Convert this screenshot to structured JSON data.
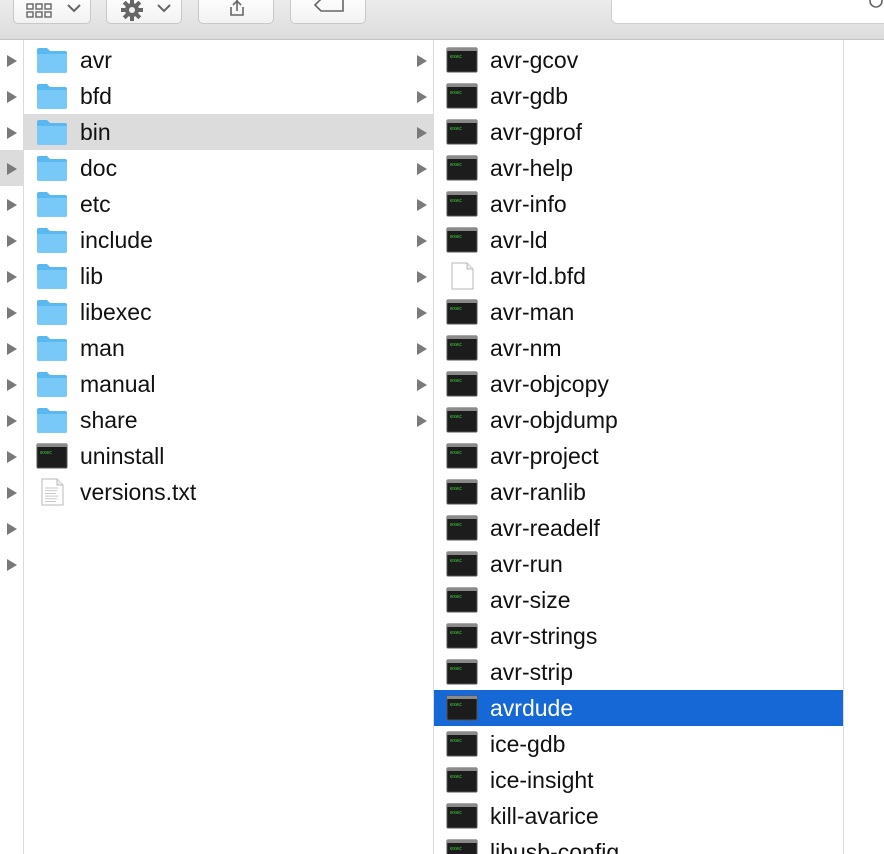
{
  "column_left": {
    "items": [
      {
        "label": "avr",
        "type": "folder",
        "has_children": true
      },
      {
        "label": "bfd",
        "type": "folder",
        "has_children": true
      },
      {
        "label": "bin",
        "type": "folder",
        "has_children": true,
        "selected": true
      },
      {
        "label": "doc",
        "type": "folder",
        "has_children": true
      },
      {
        "label": "etc",
        "type": "folder",
        "has_children": true
      },
      {
        "label": "include",
        "type": "folder",
        "has_children": true
      },
      {
        "label": "lib",
        "type": "folder",
        "has_children": true
      },
      {
        "label": "libexec",
        "type": "folder",
        "has_children": true
      },
      {
        "label": "man",
        "type": "folder",
        "has_children": true
      },
      {
        "label": "manual",
        "type": "folder",
        "has_children": true
      },
      {
        "label": "share",
        "type": "folder",
        "has_children": true
      },
      {
        "label": "uninstall",
        "type": "exec",
        "has_children": false
      },
      {
        "label": "versions.txt",
        "type": "text",
        "has_children": false
      }
    ]
  },
  "column_right": {
    "items": [
      {
        "label": "avr-gcov",
        "type": "exec"
      },
      {
        "label": "avr-gdb",
        "type": "exec"
      },
      {
        "label": "avr-gprof",
        "type": "exec"
      },
      {
        "label": "avr-help",
        "type": "exec"
      },
      {
        "label": "avr-info",
        "type": "exec"
      },
      {
        "label": "avr-ld",
        "type": "exec"
      },
      {
        "label": "avr-ld.bfd",
        "type": "doc"
      },
      {
        "label": "avr-man",
        "type": "exec"
      },
      {
        "label": "avr-nm",
        "type": "exec"
      },
      {
        "label": "avr-objcopy",
        "type": "exec"
      },
      {
        "label": "avr-objdump",
        "type": "exec"
      },
      {
        "label": "avr-project",
        "type": "exec"
      },
      {
        "label": "avr-ranlib",
        "type": "exec"
      },
      {
        "label": "avr-readelf",
        "type": "exec"
      },
      {
        "label": "avr-run",
        "type": "exec"
      },
      {
        "label": "avr-size",
        "type": "exec"
      },
      {
        "label": "avr-strings",
        "type": "exec"
      },
      {
        "label": "avr-strip",
        "type": "exec"
      },
      {
        "label": "avrdude",
        "type": "exec",
        "selected": true
      },
      {
        "label": "ice-gdb",
        "type": "exec"
      },
      {
        "label": "ice-insight",
        "type": "exec"
      },
      {
        "label": "kill-avarice",
        "type": "exec"
      },
      {
        "label": "libusb-config",
        "type": "exec"
      }
    ]
  },
  "colors": {
    "selection_blue": "#1568d6",
    "selection_gray": "#dcdcdc",
    "folder": "#6ec3f4"
  },
  "toolbar": {
    "icons": [
      "view-options-icon",
      "action-gear-icon",
      "share-icon",
      "tag-icon"
    ]
  }
}
